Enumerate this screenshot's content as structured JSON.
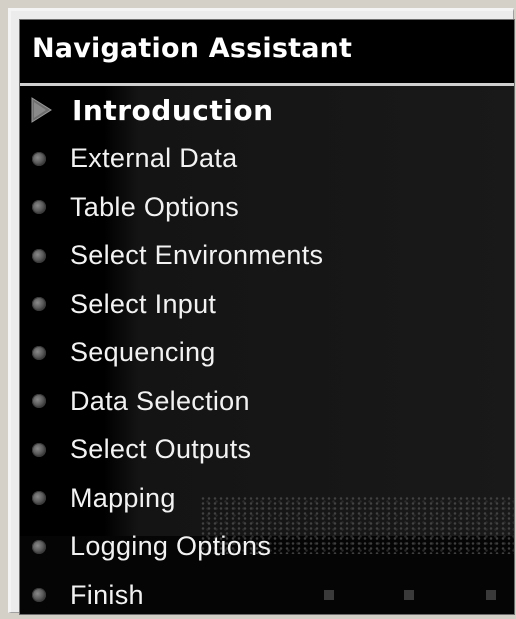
{
  "window": {
    "title": "Navigation Assistant"
  },
  "nav": {
    "items": [
      {
        "label": "Introduction",
        "active": true,
        "icon": "play-arrow-icon"
      },
      {
        "label": "External Data",
        "active": false,
        "icon": "bullet-icon"
      },
      {
        "label": "Table Options",
        "active": false,
        "icon": "bullet-icon"
      },
      {
        "label": "Select Environments",
        "active": false,
        "icon": "bullet-icon"
      },
      {
        "label": "Select Input",
        "active": false,
        "icon": "bullet-icon"
      },
      {
        "label": "Sequencing",
        "active": false,
        "icon": "bullet-icon"
      },
      {
        "label": "Data Selection",
        "active": false,
        "icon": "bullet-icon"
      },
      {
        "label": "Select Outputs",
        "active": false,
        "icon": "bullet-icon"
      },
      {
        "label": "Mapping",
        "active": false,
        "icon": "bullet-icon"
      },
      {
        "label": "Logging Options",
        "active": false,
        "icon": "bullet-icon"
      },
      {
        "label": "Finish",
        "active": false,
        "icon": "bullet-icon"
      }
    ]
  },
  "colors": {
    "background": "#000000",
    "text": "#f2f2f2",
    "header_border": "#cfcfcf",
    "bullet": "#5a5a5a",
    "arrow": "#7a7a7a"
  }
}
